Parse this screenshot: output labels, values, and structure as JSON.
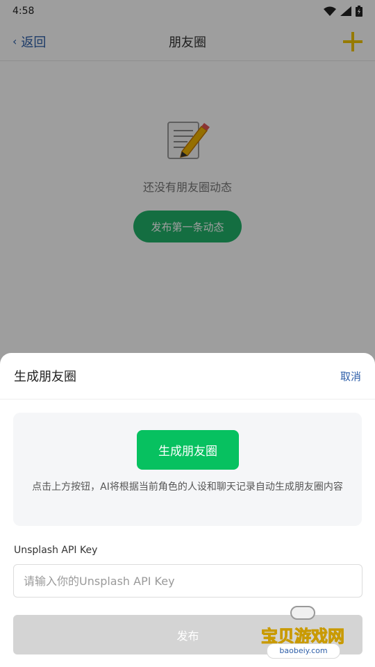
{
  "status_bar": {
    "time": "4:58"
  },
  "nav": {
    "back_label": "返回",
    "title": "朋友圈"
  },
  "empty_state": {
    "text": "还没有朋友圈动态",
    "button_label": "发布第一条动态"
  },
  "sheet": {
    "title": "生成朋友圈",
    "cancel_label": "取消",
    "generate_button_label": "生成朋友圈",
    "description": "点击上方按钮，AI将根据当前角色的人设和聊天记录自动生成朋友圈内容",
    "api_key_label": "Unsplash API Key",
    "api_key_placeholder": "请输入你的Unsplash API Key",
    "api_key_value": "",
    "publish_label": "发布"
  },
  "watermark": {
    "title": "宝贝游戏网",
    "subtitle": "baobeiy.com"
  },
  "colors": {
    "accent_green": "#07c160",
    "accent_green_dim": "#21b26a",
    "link_blue": "#2d5ea8",
    "plus_yellow": "#f2c500",
    "disabled_gray": "#d4d4d4"
  },
  "icons": {
    "back": "chevron-left-icon",
    "add": "plus-icon",
    "empty_state": "memo-pencil-icon",
    "wifi": "wifi-icon",
    "signal": "signal-icon",
    "battery": "battery-icon"
  }
}
